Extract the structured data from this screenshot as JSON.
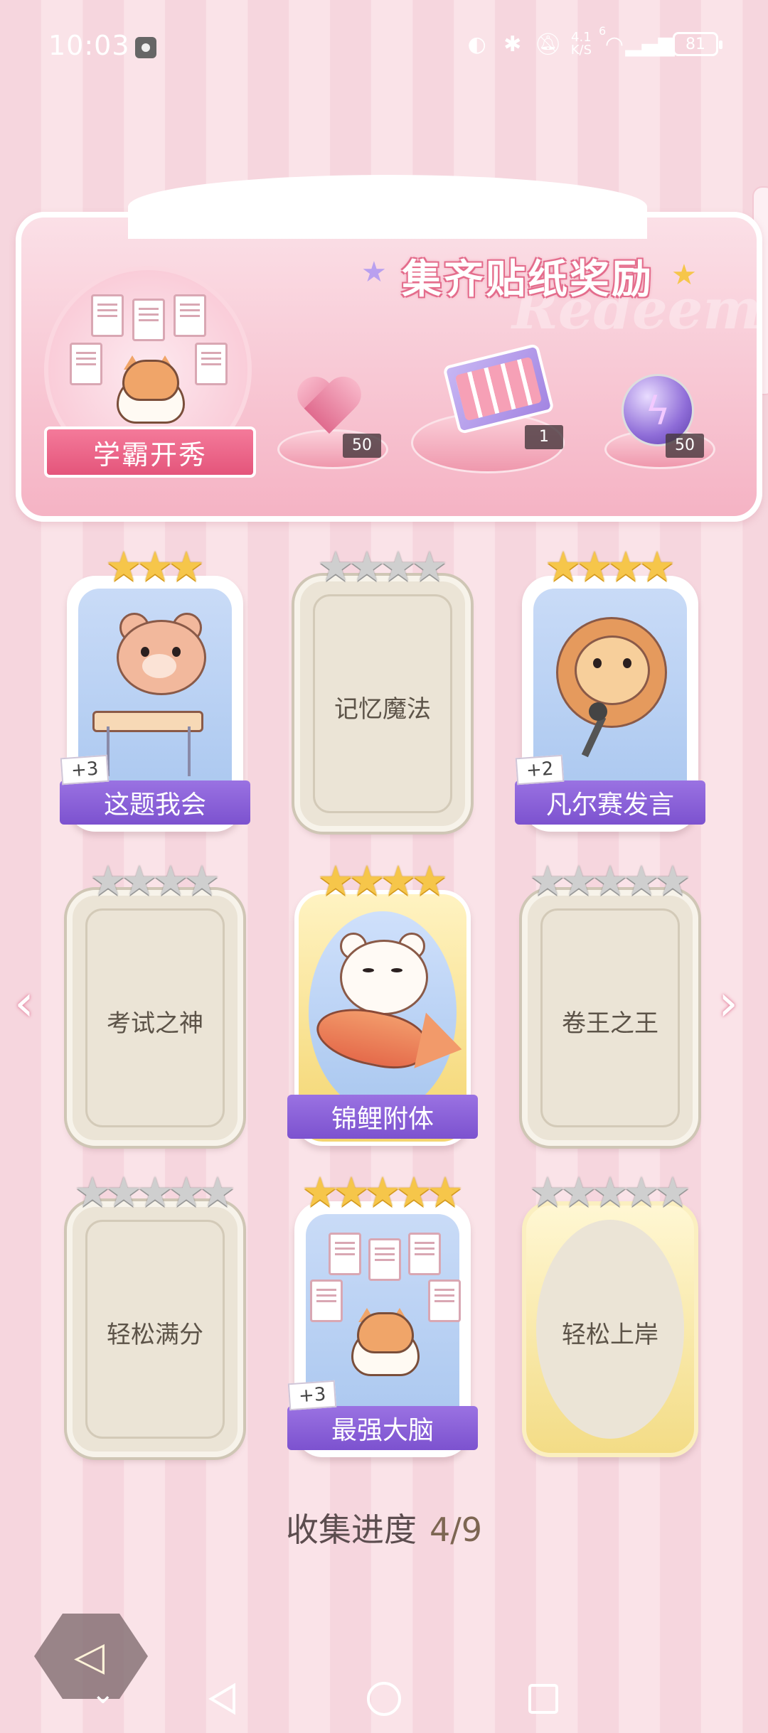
{
  "status_bar": {
    "time": "10:03",
    "net_speed_top": "4.1",
    "net_speed_bottom": "K/S",
    "signal_label": "6",
    "battery": "81"
  },
  "banner": {
    "title": "集齐贴纸奖励",
    "watermark": "Redeem",
    "avatar_label": "学霸开秀",
    "rewards": [
      {
        "icon": "pink-heart-gem-icon",
        "count": "50"
      },
      {
        "icon": "gift-box-icon",
        "count": "1"
      },
      {
        "icon": "purple-lightning-orb-icon",
        "count": "50"
      }
    ]
  },
  "cards": [
    {
      "name": "这题我会",
      "state": "unlocked",
      "stars": 3,
      "stars_total": 3,
      "bonus": "+3"
    },
    {
      "name": "记忆魔法",
      "state": "locked",
      "stars": 0,
      "stars_total": 4,
      "bonus": ""
    },
    {
      "name": "凡尔赛发言",
      "state": "unlocked",
      "stars": 4,
      "stars_total": 4,
      "bonus": "+2"
    },
    {
      "name": "考试之神",
      "state": "locked",
      "stars": 0,
      "stars_total": 4,
      "bonus": ""
    },
    {
      "name": "锦鲤附体",
      "state": "unlocked",
      "stars": 4,
      "stars_total": 4,
      "bonus": ""
    },
    {
      "name": "卷王之王",
      "state": "locked",
      "stars": 0,
      "stars_total": 5,
      "bonus": ""
    },
    {
      "name": "轻松满分",
      "state": "locked",
      "stars": 0,
      "stars_total": 5,
      "bonus": ""
    },
    {
      "name": "最强大脑",
      "state": "unlocked",
      "stars": 5,
      "stars_total": 5,
      "bonus": "+3"
    },
    {
      "name": "轻松上岸",
      "state": "locked",
      "stars": 0,
      "stars_total": 5,
      "bonus": ""
    }
  ],
  "progress": {
    "label": "收集进度",
    "value": "4/9"
  },
  "colors": {
    "accent_purple": "#8a60d8",
    "star_gold": "#f6c64a",
    "star_gray": "#cfcfcf",
    "banner_pink": "#f5b3c4"
  }
}
